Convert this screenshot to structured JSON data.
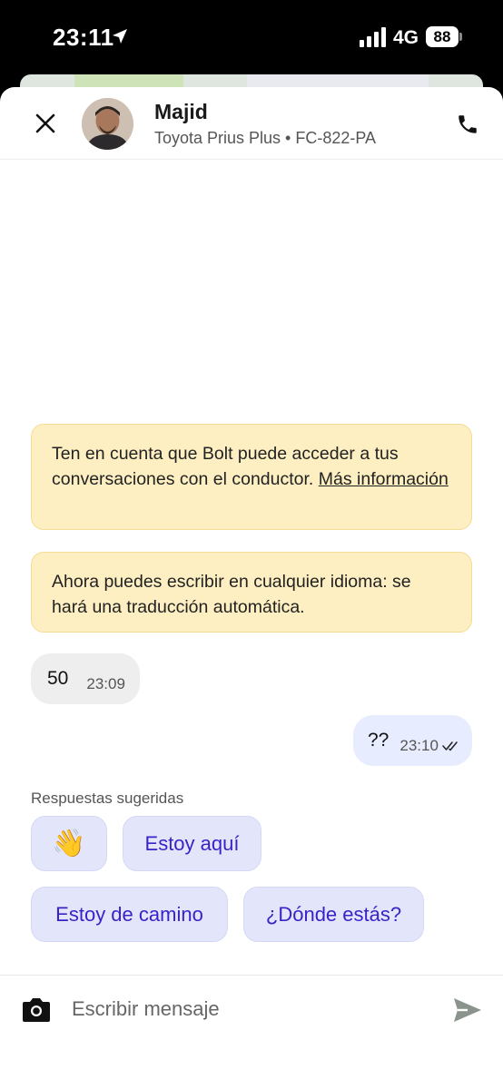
{
  "status_bar": {
    "time": "23:11",
    "network": "4G",
    "battery": "88"
  },
  "header": {
    "driver_name": "Majid",
    "vehicle": "Toyota Prius Plus • FC-822-PA"
  },
  "notices": [
    {
      "text": "Ten en cuenta que Bolt puede acceder a tus conversaciones con el conductor. ",
      "link": "Más información"
    },
    {
      "text": "Ahora puedes escribir en cualquier idioma: se hará una traducción automática."
    }
  ],
  "messages": [
    {
      "direction": "incoming",
      "text": "50",
      "time": "23:09"
    },
    {
      "direction": "outgoing",
      "text": "??",
      "time": "23:10",
      "status": "read"
    }
  ],
  "suggestions": {
    "label": "Respuestas sugeridas",
    "chips": [
      "👋",
      "Estoy aquí",
      "Estoy de camino",
      "¿Dónde estás?"
    ]
  },
  "composer": {
    "placeholder": "Escribir mensaje"
  },
  "colors": {
    "notice_bg": "#fdefc2",
    "chip_bg": "#e3e6fb",
    "chip_text": "#3a22c7",
    "outgoing_bubble": "#e8ecff",
    "incoming_bubble": "#eeeeee"
  },
  "icons": [
    "location-arrow-icon",
    "signal-icon",
    "battery-icon",
    "close-icon",
    "phone-icon",
    "camera-icon",
    "send-icon",
    "double-check-icon"
  ]
}
